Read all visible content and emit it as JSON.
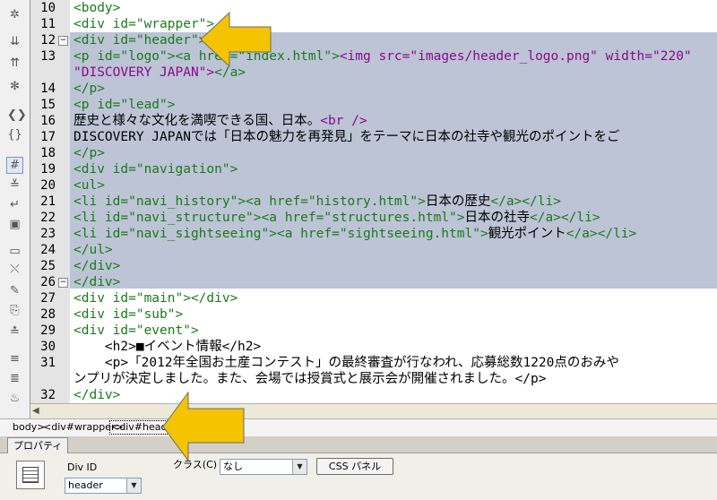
{
  "toolbar": {
    "buttons": [
      {
        "icon": "asterisk-icon",
        "glyph": "✲"
      },
      {
        "icon": "collapse-tag-icon",
        "glyph": "⇊"
      },
      {
        "icon": "expand-all-icon",
        "glyph": "⇈"
      },
      {
        "icon": "select-parent-tag-icon",
        "glyph": "✻"
      },
      {
        "icon": "balance-braces-icon",
        "glyph": "❮❯"
      },
      {
        "icon": "line-numbers-icon",
        "glyph": "{}"
      },
      {
        "icon": "highlight-invalid-icon",
        "glyph": "#"
      },
      {
        "icon": "syntax-coloring-icon",
        "glyph": "≚"
      },
      {
        "icon": "word-wrap-icon",
        "glyph": "↵"
      },
      {
        "icon": "recent-snippets-icon",
        "glyph": "▣"
      },
      {
        "icon": "apply-comment-icon",
        "glyph": "▭"
      },
      {
        "icon": "remove-comment-icon",
        "glyph": "⤬"
      },
      {
        "icon": "wrap-tag-icon",
        "glyph": "✎"
      },
      {
        "icon": "move-css-icon",
        "glyph": "⎘"
      },
      {
        "icon": "format-source-icon",
        "glyph": "≛"
      },
      {
        "icon": "indent-icon",
        "glyph": "≡"
      },
      {
        "icon": "outdent-icon",
        "glyph": "≣"
      },
      {
        "icon": "validate-icon",
        "glyph": "♨"
      }
    ]
  },
  "editor": {
    "lines": [
      {
        "n": "10",
        "fold": "",
        "segs": [
          {
            "t": "<body>",
            "c": "g"
          }
        ]
      },
      {
        "n": "11",
        "fold": "",
        "segs": [
          {
            "t": "<div id=\"wrapper\">",
            "c": "g"
          }
        ]
      },
      {
        "n": "12",
        "fold": "−",
        "segs": [
          {
            "t": "<div id=\"header\">",
            "c": "g"
          }
        ]
      },
      {
        "n": "13",
        "fold": "",
        "segs": [
          {
            "t": "<p id=\"logo\">",
            "c": "g"
          },
          {
            "t": "<a href=\"index.html\">",
            "c": "g"
          },
          {
            "t": "<img src=\"images/header_logo.png\" width=\"220\"",
            "c": "p"
          }
        ]
      },
      {
        "n": "",
        "fold": "",
        "segs": [
          {
            "t": "\"DISCOVERY JAPAN\">",
            "c": "p"
          },
          {
            "t": "</a>",
            "c": "g"
          }
        ]
      },
      {
        "n": "14",
        "fold": "",
        "segs": [
          {
            "t": "</p>",
            "c": "g"
          }
        ]
      },
      {
        "n": "15",
        "fold": "",
        "segs": [
          {
            "t": "<p id=\"lead\">",
            "c": "g"
          }
        ]
      },
      {
        "n": "16",
        "fold": "",
        "segs": [
          {
            "t": "歴史と様々な文化を満喫できる国、日本。",
            "c": "b"
          },
          {
            "t": "<br />",
            "c": "p"
          }
        ]
      },
      {
        "n": "17",
        "fold": "",
        "segs": [
          {
            "t": "DISCOVERY JAPANでは「日本の魅力を再発見」をテーマに日本の社寺や観光のポイントをご",
            "c": "b"
          }
        ]
      },
      {
        "n": "18",
        "fold": "",
        "segs": [
          {
            "t": "</p>",
            "c": "g"
          }
        ]
      },
      {
        "n": "19",
        "fold": "",
        "segs": [
          {
            "t": "<div id=\"navigation\">",
            "c": "g"
          }
        ]
      },
      {
        "n": "20",
        "fold": "",
        "segs": [
          {
            "t": "<ul>",
            "c": "g"
          }
        ]
      },
      {
        "n": "21",
        "fold": "",
        "segs": [
          {
            "t": "<li id=\"navi_history\">",
            "c": "g"
          },
          {
            "t": "<a href=\"history.html\">",
            "c": "g"
          },
          {
            "t": "日本の歴史",
            "c": "b"
          },
          {
            "t": "</a></li>",
            "c": "g"
          }
        ]
      },
      {
        "n": "22",
        "fold": "",
        "segs": [
          {
            "t": "<li id=\"navi_structure\">",
            "c": "g"
          },
          {
            "t": "<a href=\"structures.html\">",
            "c": "g"
          },
          {
            "t": "日本の社寺",
            "c": "b"
          },
          {
            "t": "</a></li>",
            "c": "g"
          }
        ]
      },
      {
        "n": "23",
        "fold": "",
        "segs": [
          {
            "t": "<li id=\"navi_sightseeing\">",
            "c": "g"
          },
          {
            "t": "<a href=\"sightseeing.html\">",
            "c": "g"
          },
          {
            "t": "観光ポイント",
            "c": "b"
          },
          {
            "t": "</a></li>",
            "c": "g"
          }
        ]
      },
      {
        "n": "24",
        "fold": "",
        "segs": [
          {
            "t": "</ul>",
            "c": "g"
          }
        ]
      },
      {
        "n": "25",
        "fold": "",
        "segs": [
          {
            "t": "</div>",
            "c": "g"
          }
        ]
      },
      {
        "n": "26",
        "fold": "−",
        "segs": [
          {
            "t": "</div>",
            "c": "g"
          }
        ]
      },
      {
        "n": "27",
        "fold": "",
        "segs": [
          {
            "t": "<div id=\"main\"></div>",
            "c": "g"
          }
        ]
      },
      {
        "n": "28",
        "fold": "",
        "segs": [
          {
            "t": "<div id=\"sub\">",
            "c": "g"
          }
        ]
      },
      {
        "n": "29",
        "fold": "",
        "segs": [
          {
            "t": "<div id=\"event\">",
            "c": "g"
          }
        ]
      },
      {
        "n": "30",
        "fold": "",
        "segs": [
          {
            "t": "    <h2>■イベント情報</h2>",
            "c": "b"
          }
        ]
      },
      {
        "n": "31",
        "fold": "",
        "segs": [
          {
            "t": "    <p>「2012年全国お土産コンテスト」の最終審査が行なわれ、応募総数1220点のおみや",
            "c": "b"
          }
        ]
      },
      {
        "n": "",
        "fold": "",
        "segs": [
          {
            "t": "ンプリが決定しました。また、会場では授賞式と展示会が開催されました。</p>",
            "c": "b"
          }
        ]
      },
      {
        "n": "32",
        "fold": "",
        "segs": [
          {
            "t": "</div>",
            "c": "g"
          }
        ]
      }
    ]
  },
  "tag_selector": {
    "crumbs": [
      "body>",
      "<div#wrapper>",
      "<div#header>"
    ]
  },
  "properties": {
    "tab_label": "プロパティ",
    "div_id_label": "Div ID",
    "div_id_value": "header",
    "class_label": "クラス(C)",
    "class_value": "なし",
    "css_button_label": "CSS パネル"
  },
  "colors": {
    "selection": "#bcc4d6",
    "tag_green": "#1a7a1a",
    "attr_purple": "#8a0a8a",
    "arrow_fill": "#f5c400"
  }
}
